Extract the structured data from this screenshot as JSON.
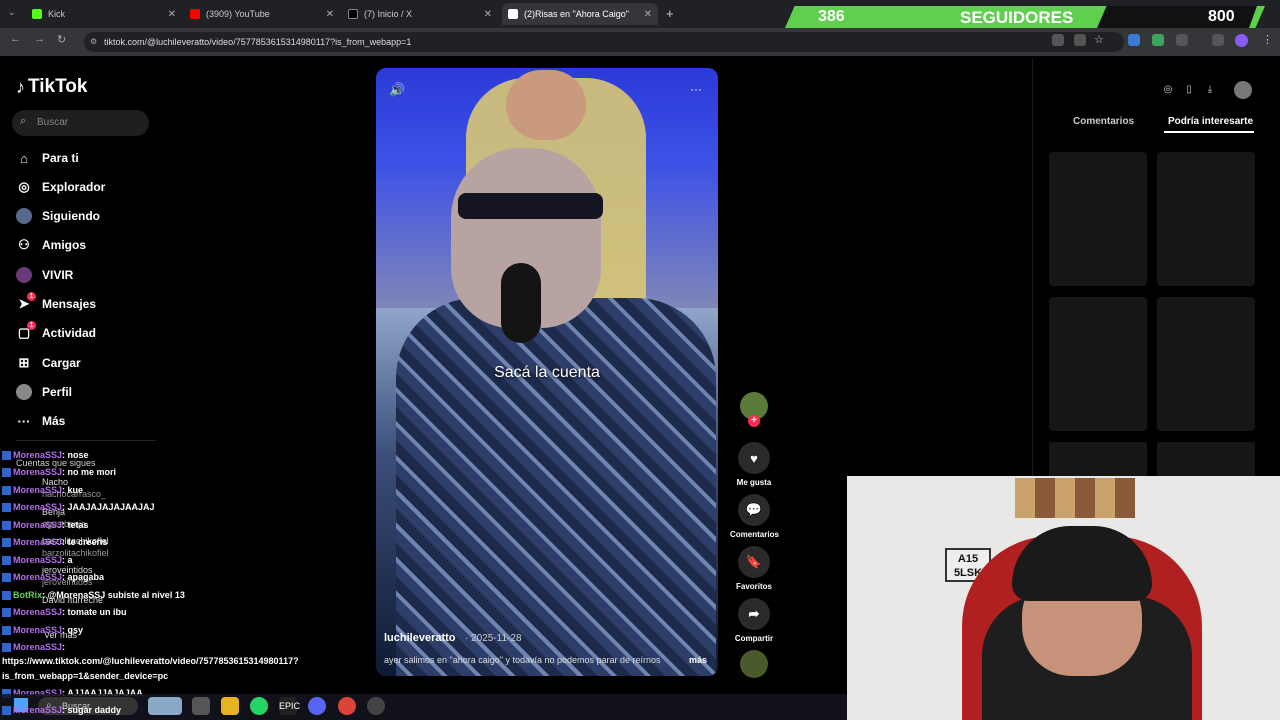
{
  "browser": {
    "tabs": [
      {
        "title": "Kick",
        "color": "#53fc18"
      },
      {
        "title": "(3909) YouTube",
        "color": "#ff0000"
      },
      {
        "title": "(7) Inicio / X",
        "color": "#000000"
      },
      {
        "title": "(2)Risas en \"Ahora Caigo\"",
        "color": "#ffffff"
      }
    ],
    "url": "tiktok.com/@luchileveratto/video/7577853615314980117?is_from_webapp=1"
  },
  "followers": {
    "count": "386",
    "title": "SEGUIDORES",
    "goal": "800",
    "progress_fraction": 0.4825
  },
  "sidebar": {
    "logo": "TikTok",
    "search_placeholder": "Buscar",
    "items": [
      {
        "label": "Para ti",
        "icon": "home-icon"
      },
      {
        "label": "Explorador",
        "icon": "compass-icon"
      },
      {
        "label": "Siguiendo",
        "icon": "following-avatar-icon"
      },
      {
        "label": "Amigos",
        "icon": "friends-icon"
      },
      {
        "label": "VIVIR",
        "icon": "live-icon"
      },
      {
        "label": "Mensajes",
        "icon": "messages-icon",
        "badge": "1"
      },
      {
        "label": "Actividad",
        "icon": "activity-icon",
        "badge": "1"
      },
      {
        "label": "Cargar",
        "icon": "upload-icon"
      },
      {
        "label": "Perfil",
        "icon": "profile-icon"
      },
      {
        "label": "Más",
        "icon": "more-icon"
      }
    ],
    "following_header": "Cuentas que sigues",
    "following": [
      "Nacho",
      "nachocarrasco_",
      "Benja",
      "agustbenja",
      "barzolitachikofiel",
      "barzolitachikofiel",
      "jeroveintidos",
      "jeroveintidos",
      "David Iturreche",
      "Ver más"
    ]
  },
  "video": {
    "caption": "Sacá la cuenta",
    "username": "luchileveratto",
    "date": "· 2025-11-28",
    "description": "ayer salimos en \"ahora caigo\" y todavía no podemos parar de reírnos",
    "more": "más",
    "actions": [
      {
        "label": "Me gusta",
        "icon": "heart-icon"
      },
      {
        "label": "Comentarios",
        "icon": "comment-icon"
      },
      {
        "label": "Favoritos",
        "icon": "bookmark-icon"
      },
      {
        "label": "Compartir",
        "icon": "share-icon"
      }
    ]
  },
  "right_panel": {
    "tabs": [
      "Comentarios",
      "Podría interesarte"
    ]
  },
  "chat": [
    {
      "user": "MorenaSSJ",
      "text": ": nose"
    },
    {
      "user": "MorenaSSJ",
      "text": ": no me mori"
    },
    {
      "user": "MorenaSSJ",
      "text": ": kue"
    },
    {
      "user": "MorenaSSJ",
      "text": ": JAAJAJAJAJAAJAJ"
    },
    {
      "user": "MorenaSSJ",
      "text": ": tetas"
    },
    {
      "user": "MorenaSSJ",
      "text": ": te creeris"
    },
    {
      "user": "MorenaSSJ",
      "text": ": a"
    },
    {
      "user": "MorenaSSJ",
      "text": ": apagaba"
    },
    {
      "user": "BotRix",
      "text": ": @MorenaSSJ subiste al nivel 13"
    },
    {
      "user": "MorenaSSJ",
      "text": ": tomate un ibu"
    },
    {
      "user": "MorenaSSJ",
      "text": ": qsy"
    },
    {
      "user": "MorenaSSJ",
      "text": ":"
    },
    {
      "user": "MorenaSSJ",
      "text": ": AJJAAJJAJAJAA"
    },
    {
      "user": "MorenaSSJ",
      "text": ": sugar daddy"
    }
  ],
  "chat_link": [
    "https://www.tiktok.com/@luchileveratto/video/7577853615314980117?",
    "is_from_webapp=1&sender_device=pc"
  ],
  "webcam": {
    "plate": "A15\n5LSK"
  },
  "taskbar": {
    "search": "Buscar"
  }
}
